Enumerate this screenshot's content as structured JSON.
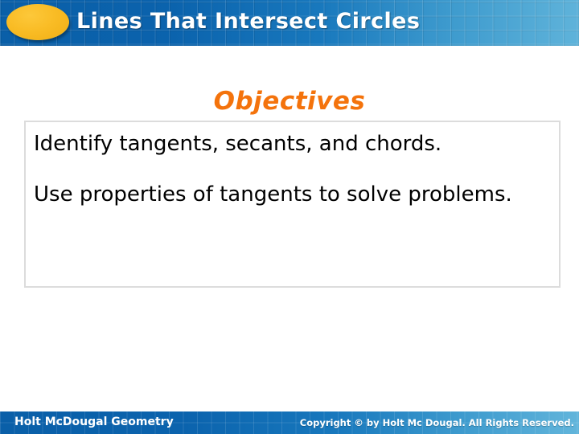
{
  "slide": {
    "title": "Lines That Intersect Circles",
    "objectives_heading": "Objectives",
    "objectives": [
      "Identify tangents, secants, and chords.",
      "Use properties of tangents to solve problems."
    ]
  },
  "footer": {
    "brand": "Holt McDougal Geometry",
    "copyright": "Copyright © by Holt Mc Dougal. All Rights Reserved."
  },
  "colors": {
    "header_blue_dark": "#0a5fa8",
    "header_blue_light": "#5fb3da",
    "accent_orange": "#f4730c",
    "bullet_ellipse_yellow": "#f9bc25",
    "box_border_gray": "#dcdcdc",
    "text_black": "#000000",
    "text_white": "#ffffff"
  }
}
